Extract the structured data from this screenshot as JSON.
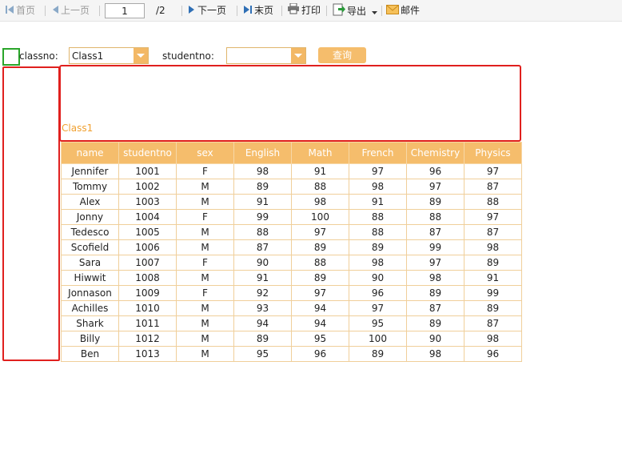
{
  "toolbar": {
    "first_label": "首页",
    "prev_label": "上一页",
    "page_value": "1",
    "total_pages": "/2",
    "next_label": "下一页",
    "last_label": "末页",
    "print_label": "打印",
    "export_label": "导出",
    "mail_label": "邮件"
  },
  "query": {
    "classno_label": "classno:",
    "classno_value": "Class1",
    "studentno_label": "studentno:",
    "studentno_value": "",
    "query_button": "查询"
  },
  "report": {
    "class_caption": "Class1",
    "columns": [
      "name",
      "studentno",
      "sex",
      "English",
      "Math",
      "French",
      "Chemistry",
      "Physics"
    ],
    "rows": [
      [
        "Jennifer",
        "1001",
        "F",
        "98",
        "91",
        "97",
        "96",
        "97"
      ],
      [
        "Tommy",
        "1002",
        "M",
        "89",
        "88",
        "98",
        "97",
        "87"
      ],
      [
        "Alex",
        "1003",
        "M",
        "91",
        "98",
        "91",
        "89",
        "88"
      ],
      [
        "Jonny",
        "1004",
        "F",
        "99",
        "100",
        "88",
        "88",
        "97"
      ],
      [
        "Tedesco",
        "1005",
        "M",
        "88",
        "97",
        "88",
        "87",
        "87"
      ],
      [
        "Scofield",
        "1006",
        "M",
        "87",
        "89",
        "89",
        "99",
        "98"
      ],
      [
        "Sara",
        "1007",
        "F",
        "90",
        "88",
        "98",
        "97",
        "89"
      ],
      [
        "Hiwwit",
        "1008",
        "M",
        "91",
        "89",
        "90",
        "98",
        "91"
      ],
      [
        "Jonnason",
        "1009",
        "F",
        "92",
        "97",
        "96",
        "89",
        "99"
      ],
      [
        "Achilles",
        "1010",
        "M",
        "93",
        "94",
        "97",
        "87",
        "89"
      ],
      [
        "Shark",
        "1011",
        "M",
        "94",
        "94",
        "95",
        "89",
        "87"
      ],
      [
        "Billy",
        "1012",
        "M",
        "89",
        "95",
        "100",
        "90",
        "98"
      ],
      [
        "Ben",
        "1013",
        "M",
        "95",
        "96",
        "89",
        "98",
        "96"
      ]
    ]
  },
  "colors": {
    "accent": "#f5bd6c",
    "highlight_red": "#e0201e",
    "highlight_green": "#2aa52a"
  }
}
